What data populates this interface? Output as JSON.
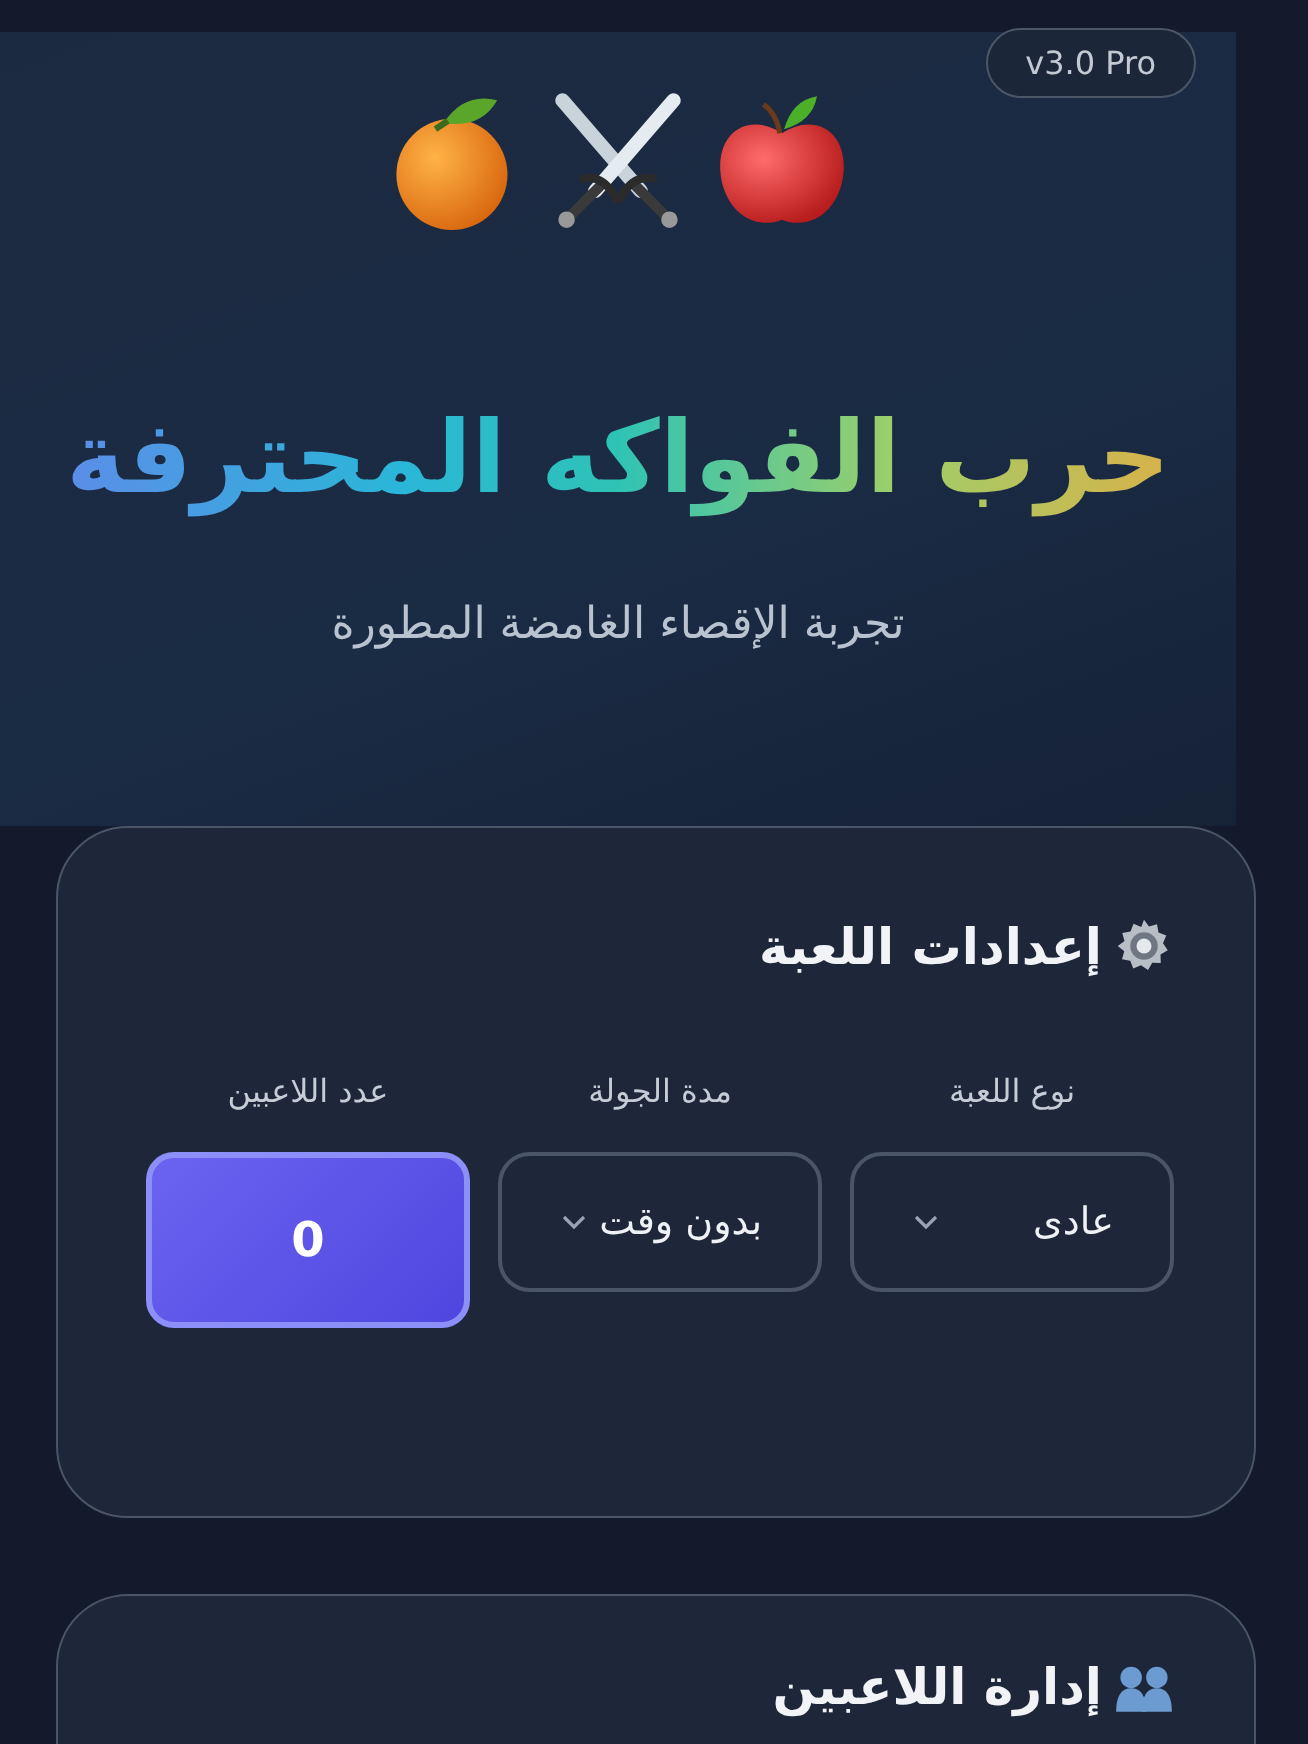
{
  "badge": "v3.0 Pro",
  "title": "حرب الفواكه المحترفة",
  "subtitle": "تجربة الإقصاء الغامضة المطورة",
  "settings": {
    "title": "إعدادات اللعبة",
    "fields": [
      {
        "kind": "select",
        "label": "نوع اللعبة",
        "value": "عادى"
      },
      {
        "kind": "select",
        "label": "مدة الجولة",
        "value": "بدون وقت"
      },
      {
        "kind": "counter",
        "label": "عدد اللاعبين",
        "value": "0"
      }
    ]
  },
  "players": {
    "title": "إدارة اللاعبين"
  }
}
